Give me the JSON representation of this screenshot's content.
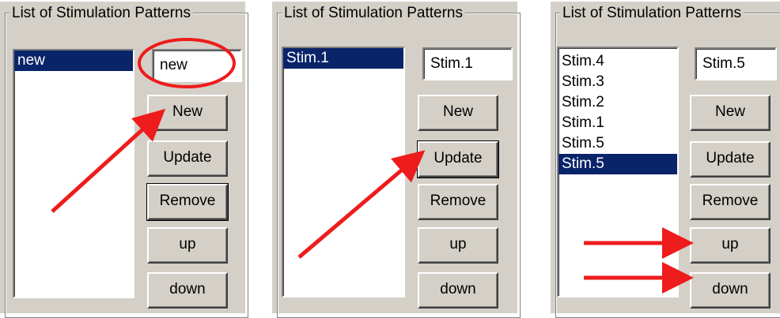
{
  "panels": [
    {
      "group_title": "List of Stimulation Patterns",
      "list_items": [
        {
          "label": "new",
          "selected": true
        }
      ],
      "text_value": "new",
      "buttons": {
        "new": "New",
        "update": "Update",
        "remove": "Remove",
        "up": "up",
        "down": "down"
      }
    },
    {
      "group_title": "List of Stimulation Patterns",
      "list_items": [
        {
          "label": "Stim.1",
          "selected": true
        }
      ],
      "text_value": "Stim.1",
      "buttons": {
        "new": "New",
        "update": "Update",
        "remove": "Remove",
        "up": "up",
        "down": "down"
      }
    },
    {
      "group_title": "List of Stimulation Patterns",
      "list_items": [
        {
          "label": "Stim.4",
          "selected": false
        },
        {
          "label": "Stim.3",
          "selected": false
        },
        {
          "label": "Stim.2",
          "selected": false
        },
        {
          "label": "Stim.1",
          "selected": false
        },
        {
          "label": "Stim.5",
          "selected": false
        },
        {
          "label": "Stim.5",
          "selected": true
        }
      ],
      "text_value": "Stim.5",
      "buttons": {
        "new": "New",
        "update": "Update",
        "remove": "Remove",
        "up": "up",
        "down": "down"
      }
    }
  ],
  "colors": {
    "window_bg": "#d4d0c8",
    "selection_bg": "#0a246a",
    "annotation": "#ee1c1c"
  }
}
